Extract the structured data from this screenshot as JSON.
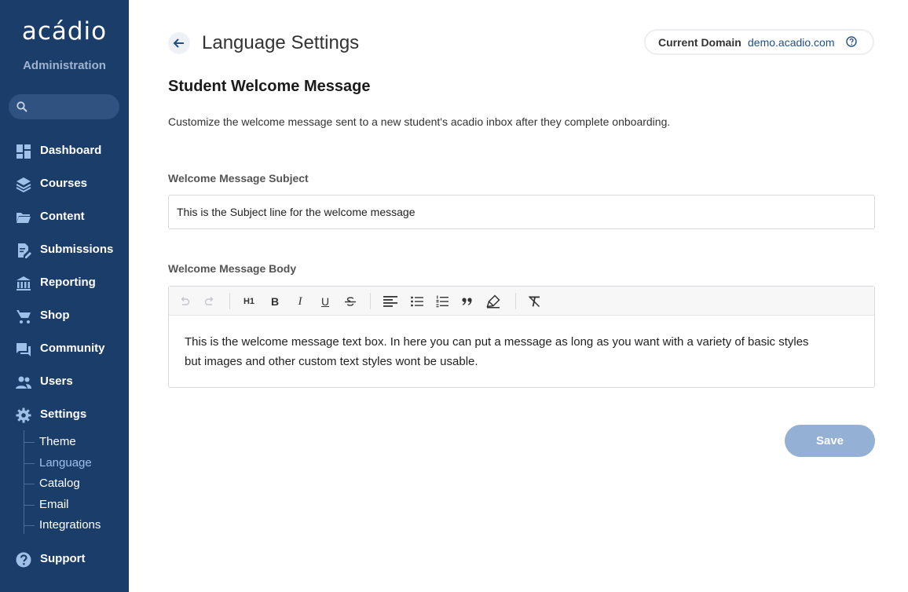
{
  "sidebar": {
    "logo": "acádio",
    "subtitle": "Administration",
    "search": {
      "placeholder": ""
    },
    "items": [
      {
        "label": "Dashboard",
        "icon": "dashboard-icon"
      },
      {
        "label": "Courses",
        "icon": "layers-icon"
      },
      {
        "label": "Content",
        "icon": "folder-icon"
      },
      {
        "label": "Submissions",
        "icon": "edit-document-icon"
      },
      {
        "label": "Reporting",
        "icon": "bank-icon"
      },
      {
        "label": "Shop",
        "icon": "cart-icon"
      },
      {
        "label": "Community",
        "icon": "chat-icon"
      },
      {
        "label": "Users",
        "icon": "users-icon"
      },
      {
        "label": "Settings",
        "icon": "gear-icon"
      }
    ],
    "settings_sub": [
      {
        "label": "Theme"
      },
      {
        "label": "Language",
        "active": true
      },
      {
        "label": "Catalog"
      },
      {
        "label": "Email"
      },
      {
        "label": "Integrations"
      }
    ],
    "support": {
      "label": "Support",
      "icon": "help-circle-icon"
    }
  },
  "header": {
    "title": "Language Settings",
    "domain_label": "Current Domain",
    "domain_value": "demo.acadio.com"
  },
  "section": {
    "title": "Student Welcome Message",
    "description": "Customize the welcome message sent to a new student's acadio inbox after they complete onboarding."
  },
  "form": {
    "subject_label": "Welcome Message Subject",
    "subject_value": "This is the Subject line for the welcome message",
    "body_label": "Welcome Message Body",
    "body_line1": "This is the welcome message text box. In here you can put a message as long as you want with a variety of basic styles",
    "body_line2": "but images and other custom text styles wont be usable.",
    "toolbar": {
      "h1": "H1",
      "bold": "B",
      "italic": "I",
      "underline": "U"
    },
    "save_label": "Save"
  },
  "colors": {
    "sidebar_bg": "#1b3d6a",
    "accent": "#1d4f8c",
    "save_bg": "#94b0d4"
  }
}
